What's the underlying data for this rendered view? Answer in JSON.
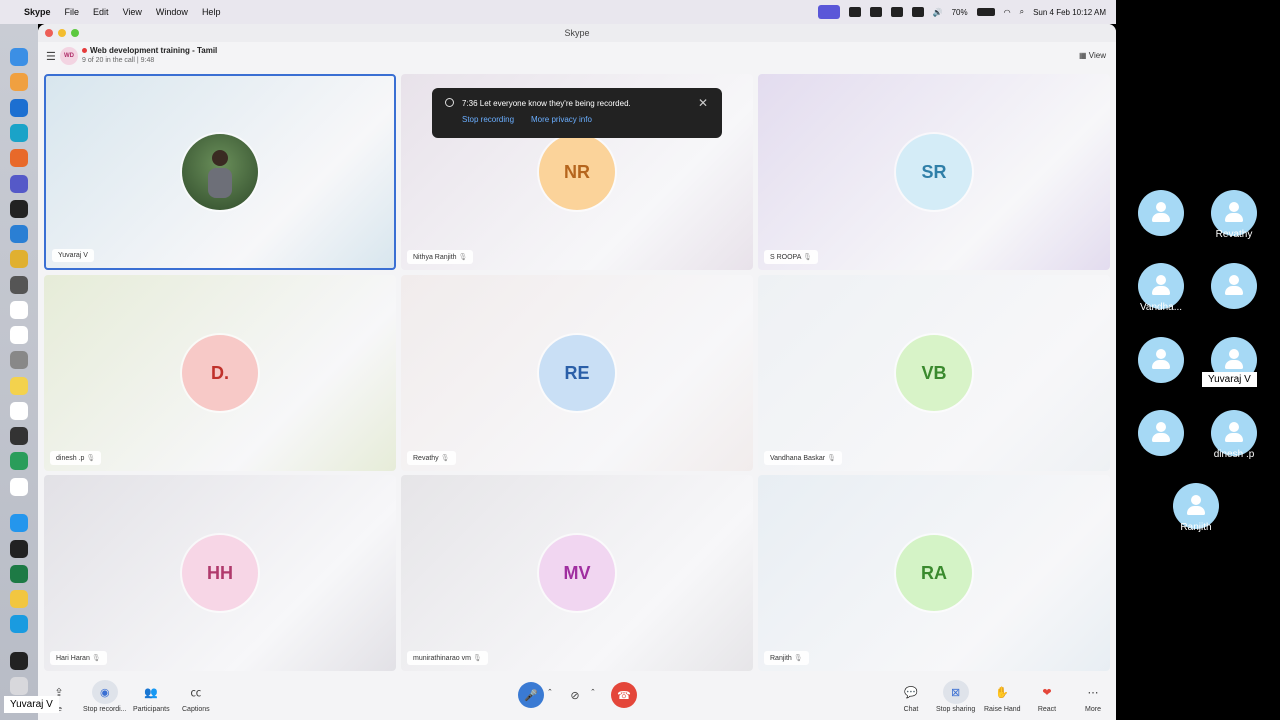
{
  "menubar": {
    "app": "Skype",
    "items": [
      "File",
      "Edit",
      "View",
      "Window",
      "Help"
    ],
    "battery": "70%",
    "datetime": "Sun 4 Feb  10:12 AM"
  },
  "window": {
    "title": "Skype"
  },
  "call": {
    "badge": "WD",
    "title": "Web development training - Tamil",
    "subtitle": "9 of 20 in the call | 9:48",
    "view_label": "View"
  },
  "toast": {
    "message": "7:36 Let everyone know they're being recorded.",
    "stop_label": "Stop recording",
    "privacy_label": "More privacy info"
  },
  "tiles": [
    {
      "name": "Yuvaraj V",
      "initials": "",
      "color": "#3a6fd3",
      "bg": "#d8e6ee",
      "photo": true
    },
    {
      "name": "Nithya Ranjith",
      "initials": "NR",
      "color": "#b5651d",
      "bg": "#e8e2ea",
      "avatar_bg": "#fbd39a"
    },
    {
      "name": "S ROOPA",
      "initials": "SR",
      "color": "#2f7fa8",
      "bg": "#e3dcef",
      "avatar_bg": "#d4ecf7"
    },
    {
      "name": "dinesh .p",
      "initials": "D.",
      "color": "#c0312b",
      "bg": "#e6ecd8",
      "avatar_bg": "#f7c9c7"
    },
    {
      "name": "Revathy",
      "initials": "RE",
      "color": "#2a5fa8",
      "bg": "#f1ecec",
      "avatar_bg": "#c9dff5"
    },
    {
      "name": "Vandhana Baskar",
      "initials": "VB",
      "color": "#3a8a2e",
      "bg": "#eef1f4",
      "avatar_bg": "#d8f3c8"
    },
    {
      "name": "Hari Haran",
      "initials": "HH",
      "color": "#b03a6c",
      "bg": "#e2e1e6",
      "avatar_bg": "#f7d6e6"
    },
    {
      "name": "munirathinarao vm",
      "initials": "MV",
      "color": "#a02ea0",
      "bg": "#e6e5e8",
      "avatar_bg": "#f1d6f1"
    },
    {
      "name": "Ranjith",
      "initials": "RA",
      "color": "#3a8a2e",
      "bg": "#e8eef3",
      "avatar_bg": "#d4f3c6"
    }
  ],
  "toolbar": {
    "left": [
      {
        "label": "te",
        "icon": "share-icon"
      },
      {
        "label": "Stop recordi...",
        "icon": "record-icon"
      },
      {
        "label": "Participants",
        "icon": "participants-icon"
      },
      {
        "label": "Captions",
        "icon": "captions-icon"
      }
    ],
    "right": [
      {
        "label": "Chat",
        "icon": "chat-icon"
      },
      {
        "label": "Stop sharing",
        "icon": "stop-sharing-icon"
      },
      {
        "label": "Raise Hand",
        "icon": "hand-icon"
      },
      {
        "label": "React",
        "icon": "heart-icon"
      },
      {
        "label": "More",
        "icon": "more-icon"
      }
    ]
  },
  "panel": {
    "names": [
      "Revathy",
      "Vandha...",
      "Yuvaraj V",
      "dinesh .p",
      "Ranjith"
    ]
  },
  "bottom_label": "Yuvaraj V"
}
